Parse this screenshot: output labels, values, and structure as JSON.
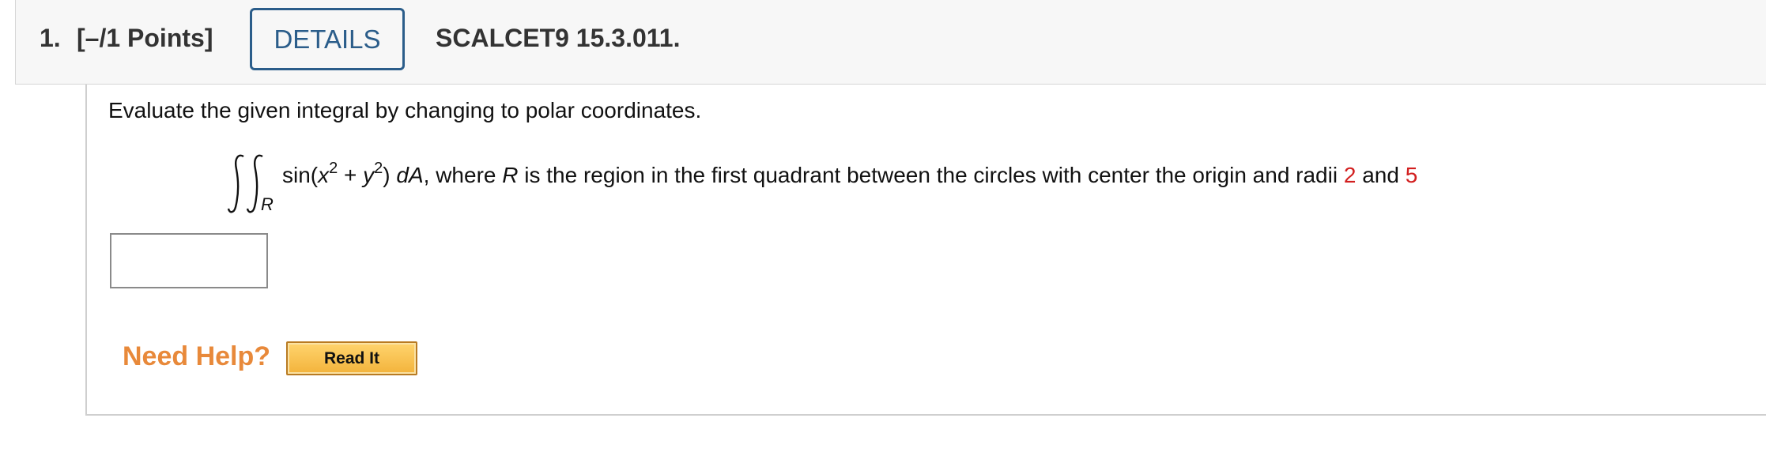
{
  "header": {
    "question_number": "1.",
    "points": "[–/1 Points]",
    "details_label": "DETAILS",
    "problem_code": "SCALCET9 15.3.011."
  },
  "question": {
    "prompt": "Evaluate the given integral by changing to polar coordinates.",
    "integral_region_sub": "R",
    "integrand_func": "sin(",
    "var_x": "x",
    "exp_x": "2",
    "plus": " + ",
    "var_y": "y",
    "exp_y": "2",
    "close_paren": ") ",
    "differential": "dA",
    "where_text": ", where ",
    "region_var": "R",
    "region_desc": " is the region in the first quadrant between the circles with center the origin and radii ",
    "radius_1": "2",
    "and_text": " and ",
    "radius_2": "5"
  },
  "answer": {
    "value": "",
    "placeholder": ""
  },
  "help": {
    "need_help_label": "Need Help?",
    "read_it_label": "Read It"
  },
  "colors": {
    "accent_blue": "#2b5d8a",
    "value_red": "#d21f1f",
    "help_orange": "#e8893a",
    "button_gold": "#f3b33b"
  }
}
